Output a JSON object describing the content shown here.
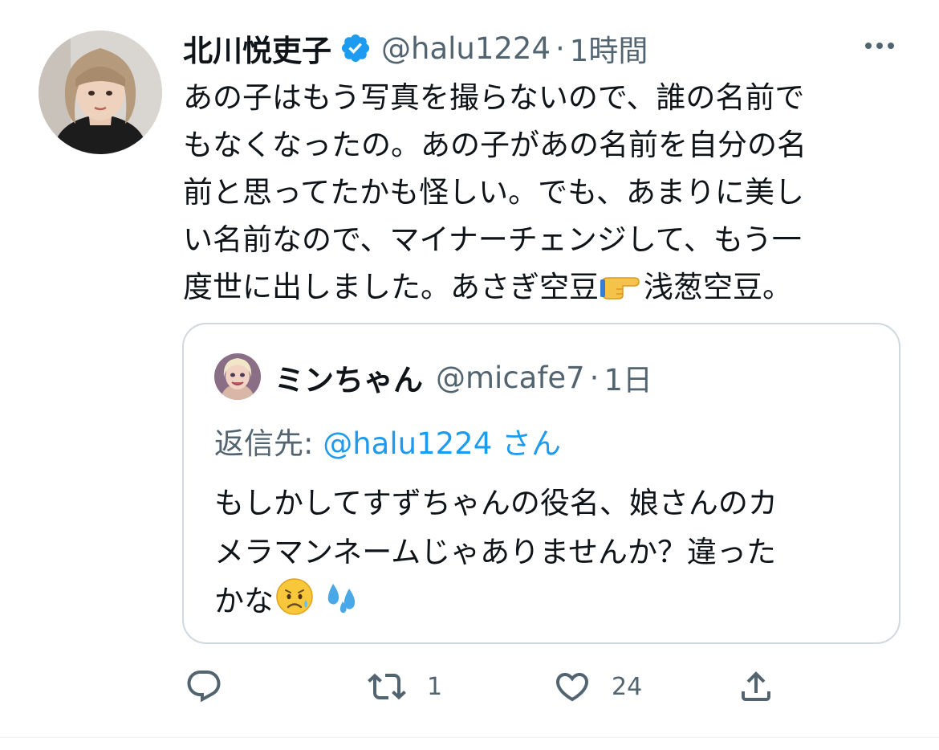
{
  "tweet": {
    "display_name": "北川悦吏子",
    "handle": "@halu1224",
    "separator": "·",
    "time": "1時間",
    "body_lines": [
      "あの子はもう写真を撮らないので、誰の名前で",
      "もなくなったの。あの子があの名前を自分の名",
      "前と思ってたかも怪しい。でも、あまりに美し",
      "い名前なので、マイナーチェンジして、もう一",
      "度世に出しました。あさぎ空豆"
    ],
    "body_tail": "浅葱空豆。",
    "verified_icon": "verified-badge-icon",
    "more_icon": "more-options-icon",
    "accent_color": "#1d9bf0"
  },
  "quote": {
    "display_name": "ミンちゃん",
    "handle": "@micafe7",
    "separator": "·",
    "time": "1日",
    "reply_prefix": "返信先: ",
    "reply_mention": "@halu1224 さん",
    "body_lines": [
      "もしかしてすずちゃんの役名、娘さんのカ",
      "メラマンネームじゃありませんか？違った",
      "かな"
    ]
  },
  "actions": {
    "reply_icon": "reply-icon",
    "retweet_icon": "retweet-icon",
    "retweet_count": "1",
    "like_icon": "heart-icon",
    "like_count": "24",
    "share_icon": "share-icon"
  }
}
